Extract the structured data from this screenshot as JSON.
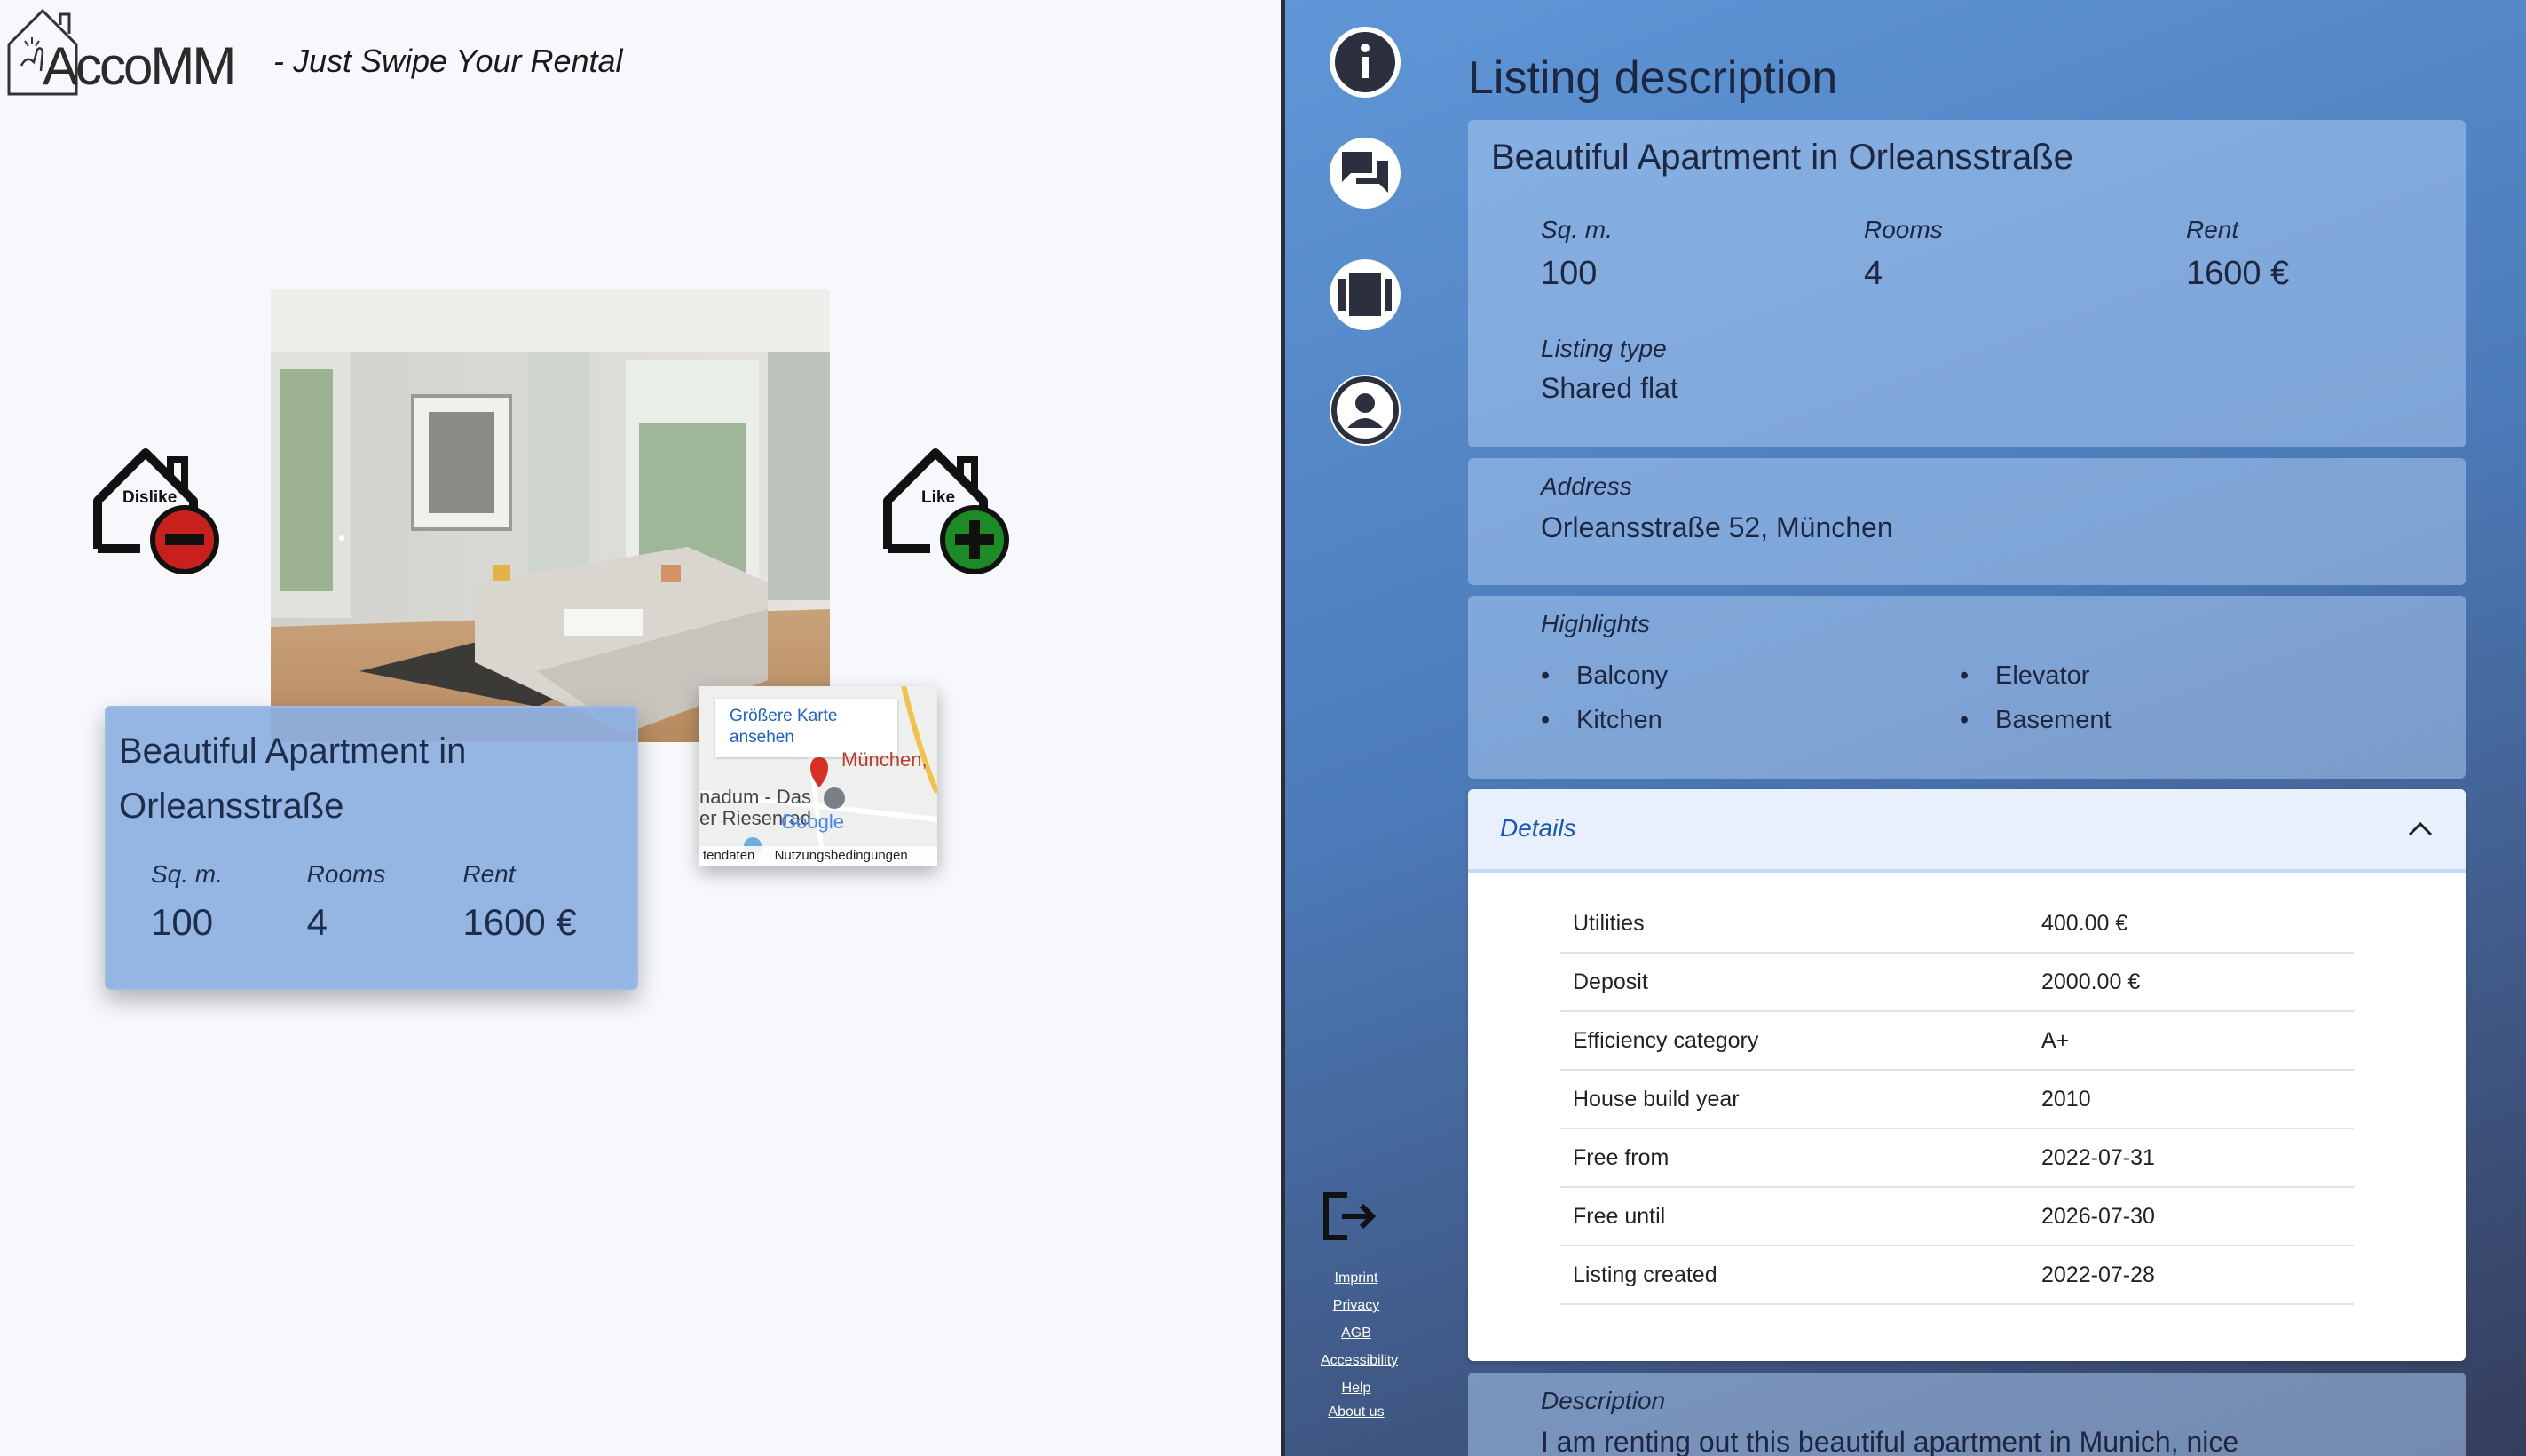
{
  "brand": {
    "name": "AccoMM",
    "tagline": "- Just Swipe Your Rental"
  },
  "swipe": {
    "dislike_label": "Dislike",
    "like_label": "Like"
  },
  "card": {
    "title": "Beautiful Apartment in Orleansstraße",
    "sqm_label": "Sq. m.",
    "sqm": "100",
    "rooms_label": "Rooms",
    "rooms": "4",
    "rent_label": "Rent",
    "rent": "1600 €"
  },
  "map": {
    "bigger_map": "Größere Karte ansehen",
    "place1": "München,",
    "place2": "nadum - Das",
    "place3": "er Riesenrad",
    "footer_left": "tendaten",
    "footer_right": "Nutzungsbedingungen",
    "google": "Google"
  },
  "nav": {
    "icons": [
      "info-icon",
      "chat-icon",
      "gallery-icon",
      "profile-icon"
    ],
    "logout_icon": "logout-icon",
    "footer_links": [
      "Imprint",
      "Privacy",
      "AGB",
      "Accessibility",
      "Help",
      "About us"
    ]
  },
  "detail": {
    "heading": "Listing description",
    "title": "Beautiful Apartment in Orleansstraße",
    "sqm_label": "Sq. m.",
    "sqm": "100",
    "rooms_label": "Rooms",
    "rooms": "4",
    "rent_label": "Rent",
    "rent": "1600 €",
    "type_label": "Listing type",
    "type": "Shared flat",
    "address_label": "Address",
    "address": "Orleansstraße 52, München",
    "highlights_label": "Highlights",
    "highlights": [
      "Balcony",
      "Elevator",
      "Kitchen",
      "Basement"
    ],
    "details_label": "Details",
    "rows": [
      {
        "k": "Utilities",
        "v": "400.00 €"
      },
      {
        "k": "Deposit",
        "v": "2000.00 €"
      },
      {
        "k": "Efficiency category",
        "v": "A+"
      },
      {
        "k": "House build year",
        "v": "2010"
      },
      {
        "k": "Free from",
        "v": "2022-07-31"
      },
      {
        "k": "Free until",
        "v": "2026-07-30"
      },
      {
        "k": "Listing created",
        "v": "2022-07-28"
      }
    ],
    "description_label": "Description",
    "description": "I am renting out this beautiful apartment in Munich, nice"
  },
  "colors": {
    "accent": "#1a56b4",
    "dislike": "#c8201c",
    "like": "#1c8a25"
  }
}
